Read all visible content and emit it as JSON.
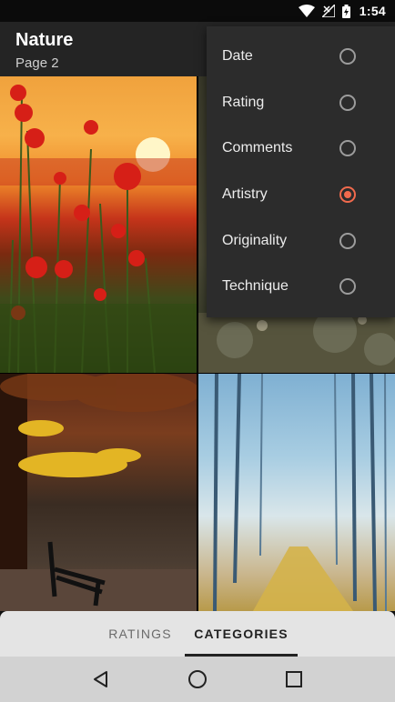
{
  "status_bar": {
    "time": "1:54",
    "icons": [
      "wifi-icon",
      "no-signal-icon",
      "battery-charging-icon"
    ]
  },
  "toolbar": {
    "title": "Nature",
    "subtitle": "Page 2"
  },
  "sort_menu": {
    "items": [
      {
        "label": "Date",
        "selected": false
      },
      {
        "label": "Rating",
        "selected": false
      },
      {
        "label": "Comments",
        "selected": false
      },
      {
        "label": "Artistry",
        "selected": true
      },
      {
        "label": "Originality",
        "selected": false
      },
      {
        "label": "Technique",
        "selected": false
      }
    ],
    "accent_color": "#f16a4d"
  },
  "photos": [
    "poppies-sunset-photo",
    "forest-moss-photo",
    "autumn-bench-photo",
    "misty-forest-path-photo"
  ],
  "tabs": [
    {
      "label": "RATINGS",
      "active": false
    },
    {
      "label": "CATEGORIES",
      "active": true
    }
  ],
  "nav_bar": {
    "icons": [
      "back-icon",
      "home-icon",
      "recents-icon"
    ]
  }
}
